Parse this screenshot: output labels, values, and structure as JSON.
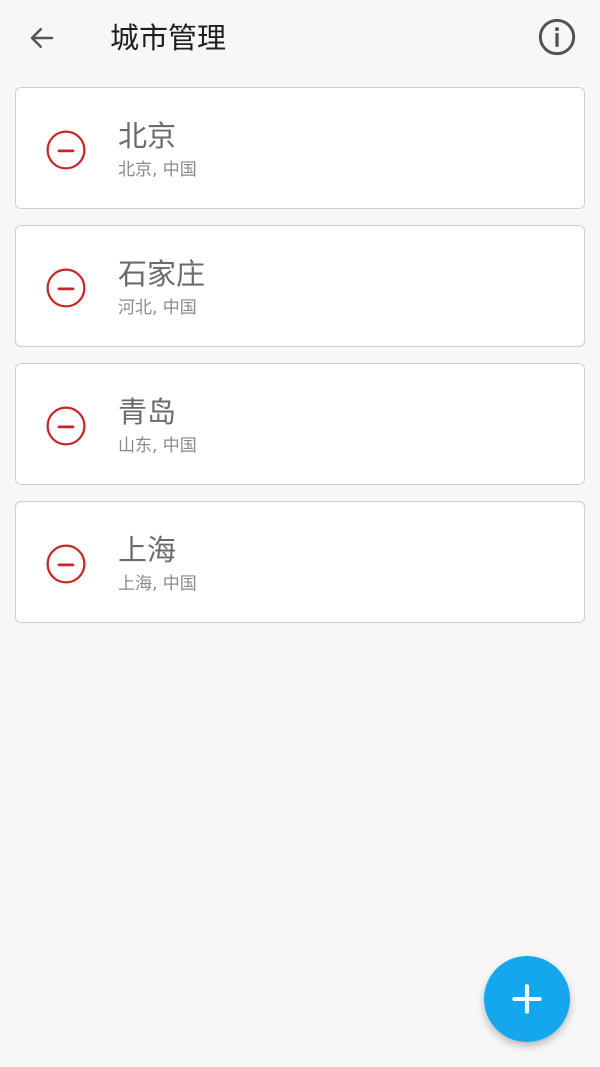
{
  "toolbar": {
    "title": "城市管理",
    "back_icon": "arrow-left-icon",
    "info_icon": "info-icon"
  },
  "cities": [
    {
      "name": "北京",
      "sub": "北京, 中国"
    },
    {
      "name": "石家庄",
      "sub": "河北, 中国"
    },
    {
      "name": "青岛",
      "sub": "山东, 中国"
    },
    {
      "name": "上海",
      "sub": "上海, 中国"
    }
  ],
  "fab": {
    "icon": "plus-icon"
  },
  "colors": {
    "remove": "#c62828",
    "fab": "#14a7ee",
    "background": "#f7f7f7",
    "card_border": "#cfcfcf"
  }
}
